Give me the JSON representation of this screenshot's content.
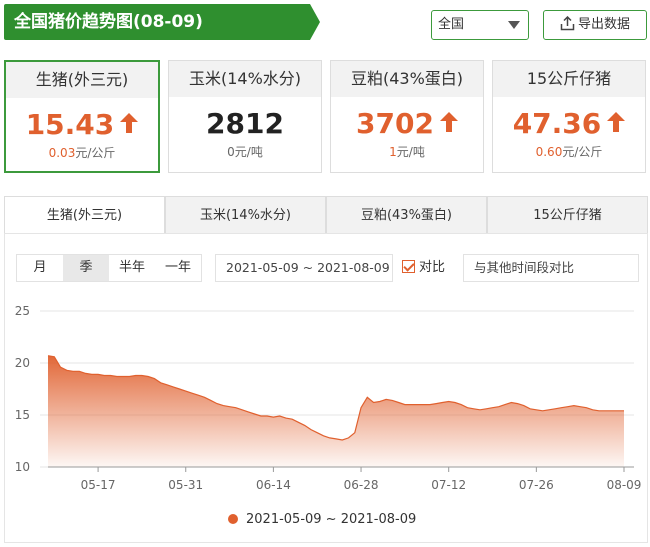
{
  "header": {
    "title": "全国猪价趋势图(08-09)"
  },
  "toolbar": {
    "region": "全国",
    "export_label": "导出数据"
  },
  "cards": [
    {
      "name": "生猪(外三元)",
      "price": "15.43",
      "change_num": "0.03",
      "change_unit": "元/公斤",
      "trend": "up"
    },
    {
      "name": "玉米(14%水分)",
      "price": "2812",
      "change_num": "0",
      "change_unit": "元/吨",
      "trend": "flat"
    },
    {
      "name": "豆粕(43%蛋白)",
      "price": "3702",
      "change_num": "1",
      "change_unit": "元/吨",
      "trend": "up"
    },
    {
      "name": "15公斤仔猪",
      "price": "47.36",
      "change_num": "0.60",
      "change_unit": "元/公斤",
      "trend": "up"
    }
  ],
  "tabs": [
    "生猪(外三元)",
    "玉米(14%水分)",
    "豆粕(43%蛋白)",
    "15公斤仔猪"
  ],
  "range_options": [
    "月",
    "季",
    "半年",
    "一年"
  ],
  "selected_range": "季",
  "date_range": "2021-05-09 ~ 2021-08-09",
  "compare_label": "对比",
  "compare_other": "与其他时间段对比",
  "colors": {
    "brand": "#2f8f2f",
    "accent": "#e0602e"
  },
  "chart_data": {
    "type": "area",
    "ylim": [
      10,
      25
    ],
    "yticks": [
      10,
      15,
      20,
      25
    ],
    "x_tick_labels": [
      "05-17",
      "05-31",
      "06-14",
      "06-28",
      "07-12",
      "07-26",
      "08-09"
    ],
    "legend": "2021-05-09 ~ 2021-08-09",
    "x": [
      "05-09",
      "05-10",
      "05-11",
      "05-12",
      "05-13",
      "05-14",
      "05-15",
      "05-16",
      "05-17",
      "05-18",
      "05-19",
      "05-20",
      "05-21",
      "05-22",
      "05-23",
      "05-24",
      "05-25",
      "05-26",
      "05-27",
      "05-28",
      "05-29",
      "05-30",
      "05-31",
      "06-01",
      "06-02",
      "06-03",
      "06-04",
      "06-05",
      "06-06",
      "06-07",
      "06-08",
      "06-09",
      "06-10",
      "06-11",
      "06-12",
      "06-13",
      "06-14",
      "06-15",
      "06-16",
      "06-17",
      "06-18",
      "06-19",
      "06-20",
      "06-21",
      "06-22",
      "06-23",
      "06-24",
      "06-25",
      "06-26",
      "06-27",
      "06-28",
      "06-29",
      "06-30",
      "07-01",
      "07-02",
      "07-03",
      "07-04",
      "07-05",
      "07-06",
      "07-07",
      "07-08",
      "07-09",
      "07-10",
      "07-11",
      "07-12",
      "07-13",
      "07-14",
      "07-15",
      "07-16",
      "07-17",
      "07-18",
      "07-19",
      "07-20",
      "07-21",
      "07-22",
      "07-23",
      "07-24",
      "07-25",
      "07-26",
      "07-27",
      "07-28",
      "07-29",
      "07-30",
      "07-31",
      "08-01",
      "08-02",
      "08-03",
      "08-04",
      "08-05",
      "08-06",
      "08-07",
      "08-08",
      "08-09"
    ],
    "series": [
      {
        "values": [
          20.7,
          20.6,
          19.6,
          19.3,
          19.2,
          19.2,
          19.0,
          18.9,
          18.9,
          18.8,
          18.8,
          18.7,
          18.7,
          18.7,
          18.8,
          18.8,
          18.7,
          18.5,
          18.1,
          17.9,
          17.7,
          17.5,
          17.3,
          17.1,
          16.9,
          16.7,
          16.4,
          16.1,
          15.9,
          15.8,
          15.7,
          15.5,
          15.3,
          15.1,
          14.9,
          14.9,
          14.8,
          14.9,
          14.7,
          14.6,
          14.3,
          14.0,
          13.6,
          13.3,
          13.0,
          12.8,
          12.7,
          12.6,
          12.8,
          13.3,
          15.7,
          16.7,
          16.2,
          16.3,
          16.5,
          16.4,
          16.2,
          16.0,
          16.0,
          16.0,
          16.0,
          16.0,
          16.1,
          16.2,
          16.3,
          16.2,
          16.0,
          15.7,
          15.6,
          15.5,
          15.6,
          15.7,
          15.8,
          16.0,
          16.2,
          16.1,
          15.9,
          15.6,
          15.5,
          15.4,
          15.5,
          15.6,
          15.7,
          15.8,
          15.9,
          15.8,
          15.7,
          15.5,
          15.4,
          15.4,
          15.4,
          15.4,
          15.4
        ]
      }
    ]
  }
}
